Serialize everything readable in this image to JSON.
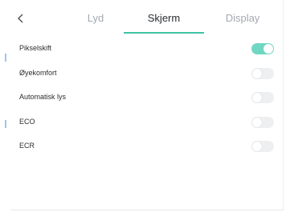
{
  "tabs": [
    {
      "label": "Lyd",
      "active": false
    },
    {
      "label": "Skjerm",
      "active": true
    },
    {
      "label": "Display",
      "active": false
    }
  ],
  "settings": [
    {
      "label": "Pikselskift",
      "enabled": true
    },
    {
      "label": "Øyekomfort",
      "enabled": false
    },
    {
      "label": "Automatisk lys",
      "enabled": false
    },
    {
      "label": "ECO",
      "enabled": false
    },
    {
      "label": "ECR",
      "enabled": false
    }
  ],
  "colors": {
    "accent": "#3fc2a6",
    "toggle_on": "#6fd7c2",
    "toggle_off": "#eeeff1",
    "inactive_tab": "#a3a9b0",
    "text": "#2a2d31"
  },
  "icons": {
    "back": "chevron-left-icon"
  }
}
